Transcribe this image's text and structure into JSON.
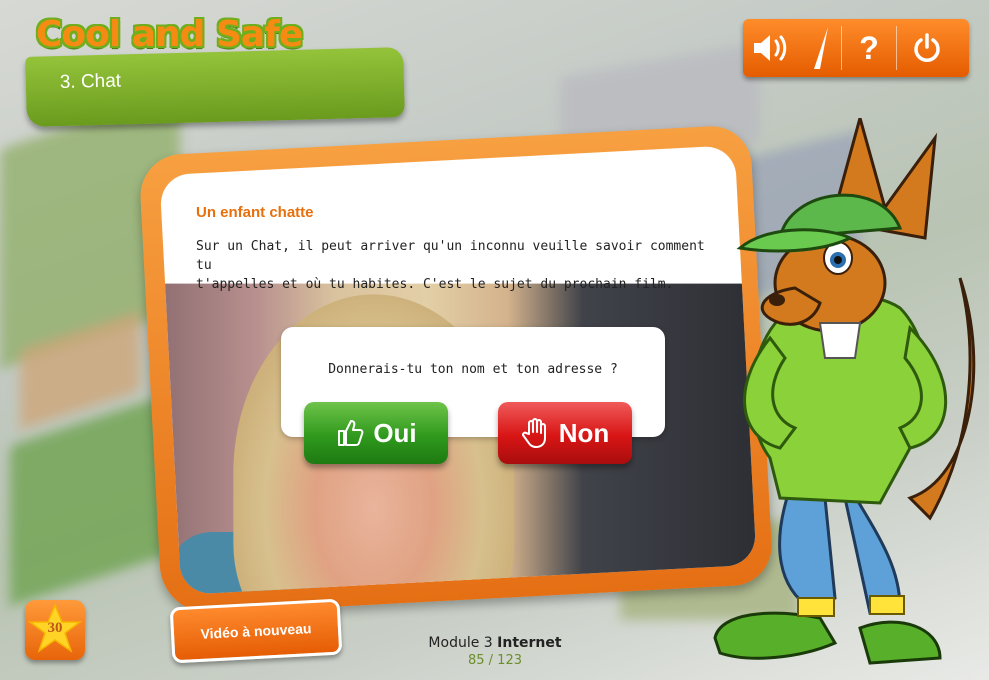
{
  "header": {
    "app_title": "Cool and Safe",
    "chapter": "3. Chat"
  },
  "toolbar": {
    "icons": [
      "speaker-icon",
      "volume-level-icon",
      "help-icon",
      "power-icon"
    ],
    "help_label": "?"
  },
  "card": {
    "title": "Un enfant chatte",
    "body_line1": "Sur un Chat, il peut arriver qu'un inconnu veuille savoir comment tu",
    "body_line2": "t'appelles et où tu habites. C'est le sujet du prochain film."
  },
  "quiz": {
    "question": "Donnerais-tu ton nom et ton adresse ?",
    "yes_label": "Oui",
    "no_label": "Non"
  },
  "score": {
    "points": "30"
  },
  "replay_button": "Vidéo à nouveau",
  "footer": {
    "module_prefix": "Module 3",
    "module_name": "Internet",
    "progress": "85 / 123"
  },
  "colors": {
    "accent_orange": "#f07a1c",
    "accent_green": "#7cb32a",
    "yes_green": "#2f9a1d",
    "no_red": "#d81515"
  }
}
